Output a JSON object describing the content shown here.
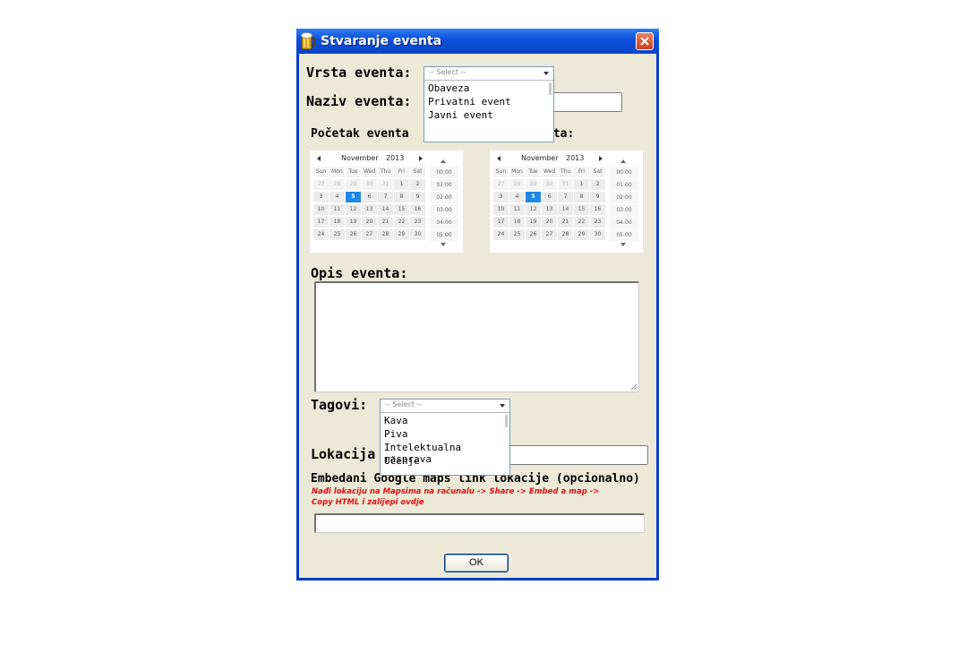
{
  "window": {
    "title": "Stvaranje eventa",
    "close_glyph": "✕",
    "icon": "beer-mug-icon"
  },
  "form": {
    "vrsta_label": "Vrsta eventa:",
    "vrsta_dropdown": {
      "placeholder": "-- Select --",
      "options": [
        "Obaveza",
        "Privatni event",
        "Javni event"
      ]
    },
    "naziv_label": "Naziv eventa:",
    "pocetak_label": "Početak eventa",
    "kraj_label_suffix": "nta:",
    "calendar": {
      "month": "November",
      "year": "2013",
      "weekdays": [
        "Sun",
        "Mon",
        "Tue",
        "Wed",
        "Thu",
        "Fri",
        "Sat"
      ],
      "weeks": [
        [
          "27",
          "28",
          "29",
          "30",
          "31",
          "1",
          "2"
        ],
        [
          "3",
          "4",
          "5",
          "6",
          "7",
          "8",
          "9"
        ],
        [
          "10",
          "11",
          "12",
          "13",
          "14",
          "15",
          "16"
        ],
        [
          "17",
          "18",
          "19",
          "20",
          "21",
          "22",
          "23"
        ],
        [
          "24",
          "25",
          "26",
          "27",
          "28",
          "29",
          "30"
        ]
      ],
      "selected_day": "5",
      "times": [
        "00:00",
        "01:00",
        "02:00",
        "03:00",
        "04:00",
        "05:00"
      ]
    },
    "opis_label": "Opis eventa:",
    "tagovi_label": "Tagovi:",
    "tagovi_dropdown": {
      "placeholder": "-- Select --",
      "options": [
        "Kava",
        "Piva",
        "Intelektualna rasprava",
        "Učenje"
      ]
    },
    "lokacija_label": "Lokacija",
    "maps_label": "Embedani Google maps link lokacije (opcionalno)",
    "maps_hint_line1": "Nađi lokaciju na Mapsima na računalu -> Share -> Embed a map ->",
    "maps_hint_line2": "Copy HTML i zalijepi ovdje",
    "ok_label": "OK"
  },
  "colors": {
    "title_bar": "#0b4fd8",
    "client_bg": "#ece9d8",
    "hint_red": "#e01010",
    "selected_day": "#1e88e5"
  }
}
